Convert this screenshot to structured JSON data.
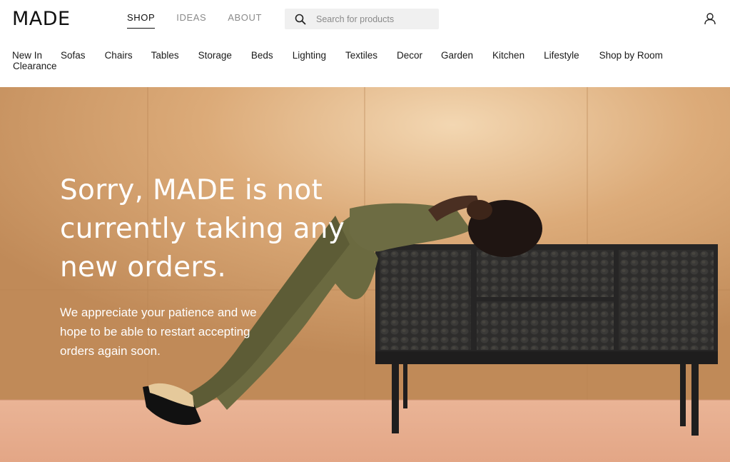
{
  "header": {
    "logo": "MADE",
    "nav": [
      {
        "label": "SHOP",
        "active": true
      },
      {
        "label": "IDEAS",
        "active": false
      },
      {
        "label": "ABOUT",
        "active": false
      }
    ],
    "search": {
      "placeholder": "Search for products",
      "value": ""
    },
    "account_icon": "user-icon"
  },
  "categories": [
    "New In",
    "Sofas",
    "Chairs",
    "Tables",
    "Storage",
    "Beds",
    "Lighting",
    "Textiles",
    "Decor",
    "Garden",
    "Kitchen",
    "Lifestyle",
    "Shop by Room",
    "Clearance"
  ],
  "hero": {
    "title_lines": [
      "Sorry, MADE is not",
      "currently taking any",
      "new orders."
    ],
    "subtitle_lines": [
      "We appreciate your patience and we",
      "hope to be able to restart accepting",
      "orders again soon."
    ]
  },
  "colors": {
    "wall": "#d9a877",
    "floor": "#e8ad8c",
    "sideboard": "#2b2a2a",
    "trousers": "#6b6a40"
  }
}
